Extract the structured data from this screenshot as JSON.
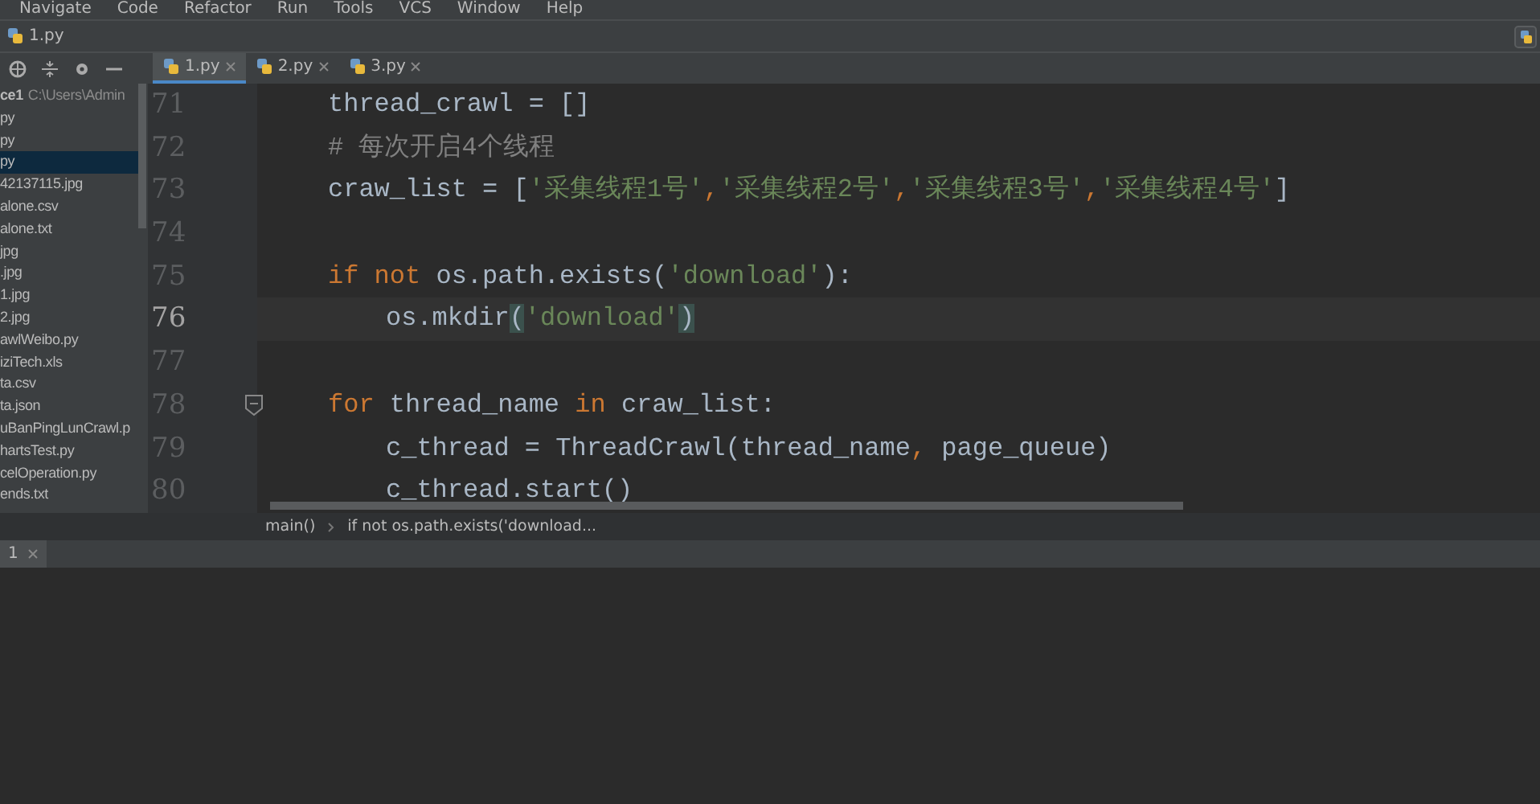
{
  "menu": [
    "Navigate",
    "Code",
    "Refactor",
    "Run",
    "Tools",
    "VCS",
    "Window",
    "Help"
  ],
  "nav_bar": {
    "file": "1.py"
  },
  "tabs": [
    {
      "label": "1.py",
      "selected": true
    },
    {
      "label": "2.py",
      "selected": false
    },
    {
      "label": "3.py",
      "selected": false
    }
  ],
  "project": {
    "root": "ce1",
    "path": "C:\\Users\\Admin",
    "items": [
      {
        "label": "py",
        "selected": false
      },
      {
        "label": "py",
        "selected": false
      },
      {
        "label": "py",
        "selected": true
      },
      {
        "label": "42137115.jpg",
        "selected": false
      },
      {
        "label": "alone.csv",
        "selected": false
      },
      {
        "label": "alone.txt",
        "selected": false
      },
      {
        "label": "jpg",
        "selected": false
      },
      {
        "label": ".jpg",
        "selected": false
      },
      {
        "label": "1.jpg",
        "selected": false
      },
      {
        "label": "2.jpg",
        "selected": false
      },
      {
        "label": "awlWeibo.py",
        "selected": false
      },
      {
        "label": "iziTech.xls",
        "selected": false
      },
      {
        "label": "ta.csv",
        "selected": false
      },
      {
        "label": "ta.json",
        "selected": false
      },
      {
        "label": "uBanPingLunCrawl.p",
        "selected": false
      },
      {
        "label": "hartsTest.py",
        "selected": false
      },
      {
        "label": "celOperation.py",
        "selected": false
      },
      {
        "label": "ends.txt",
        "selected": false
      }
    ]
  },
  "editor": {
    "lines": [
      {
        "number": "71",
        "indent": false,
        "current": false,
        "fold": false,
        "tokens": [
          {
            "kind": "plain",
            "text": "thread_crawl = []"
          }
        ]
      },
      {
        "number": "72",
        "indent": false,
        "current": false,
        "fold": false,
        "tokens": [
          {
            "kind": "comment",
            "text": "# 每次开启4个线程"
          }
        ]
      },
      {
        "number": "73",
        "indent": false,
        "current": false,
        "fold": false,
        "tokens": [
          {
            "kind": "plain",
            "text": "craw_list = ["
          },
          {
            "kind": "string",
            "text": "'采集线程1号'"
          },
          {
            "kind": "comma",
            "text": ","
          },
          {
            "kind": "string",
            "text": "'采集线程2号'"
          },
          {
            "kind": "comma",
            "text": ","
          },
          {
            "kind": "string",
            "text": "'采集线程3号'"
          },
          {
            "kind": "comma",
            "text": ","
          },
          {
            "kind": "string",
            "text": "'采集线程4号'"
          },
          {
            "kind": "plain",
            "text": "]"
          }
        ]
      },
      {
        "number": "74",
        "current": false,
        "fold": false
      },
      {
        "number": "75",
        "indent": false,
        "current": false,
        "fold": false,
        "tokens": [
          {
            "kind": "keyword",
            "text": "if not"
          },
          {
            "kind": "plain",
            "text": " os.path.exists("
          },
          {
            "kind": "string",
            "text": "'download'"
          },
          {
            "kind": "plain",
            "text": "):"
          }
        ]
      },
      {
        "number": "76",
        "indent": true,
        "current": true,
        "fold": false,
        "tokens": [
          {
            "kind": "plain",
            "text": "os.mkdir"
          },
          {
            "kind": "match",
            "text": "("
          },
          {
            "kind": "string",
            "text": "'download'"
          },
          {
            "kind": "match",
            "text": ")"
          }
        ]
      },
      {
        "number": "77",
        "current": false,
        "fold": false
      },
      {
        "number": "78",
        "indent": false,
        "current": false,
        "fold": true,
        "tokens": [
          {
            "kind": "keyword",
            "text": "for"
          },
          {
            "kind": "plain",
            "text": " thread_name "
          },
          {
            "kind": "keyword",
            "text": "in"
          },
          {
            "kind": "plain",
            "text": " craw_list:"
          }
        ]
      },
      {
        "number": "79",
        "indent": true,
        "current": false,
        "fold": false,
        "tokens": [
          {
            "kind": "plain",
            "text": "c_thread = ThreadCrawl(thread_name"
          },
          {
            "kind": "comma",
            "text": ","
          },
          {
            "kind": "plain",
            "text": " page_queue)"
          }
        ]
      },
      {
        "number": "80",
        "indent": true,
        "current": false,
        "fold": false,
        "tokens": [
          {
            "kind": "plain",
            "text": "c_thread.start()"
          }
        ]
      }
    ]
  },
  "breadcrumbs": [
    "main()",
    "if not os.path.exists('download..."
  ],
  "bottom_tab": {
    "label": "1"
  }
}
